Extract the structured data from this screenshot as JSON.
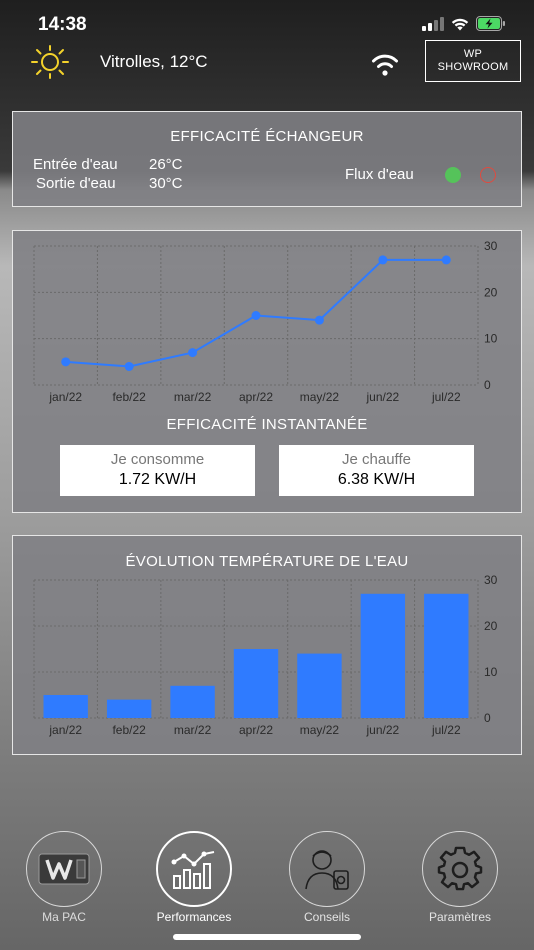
{
  "status": {
    "time": "14:38"
  },
  "header": {
    "location": "Vitrolles, 12°C",
    "showroom_line1": "WP",
    "showroom_line2": "SHOWROOM"
  },
  "exchanger": {
    "title": "EFFICACITÉ ÉCHANGEUR",
    "inlet_label": "Entrée d'eau",
    "inlet_value": "26°C",
    "outlet_label": "Sortie d'eau",
    "outlet_value": "30°C",
    "flow_label": "Flux d'eau",
    "flow_on_color": "#55c35a",
    "flow_off_color": "#e04b3f"
  },
  "instant": {
    "title": "EFFICACITÉ INSTANTANÉE",
    "consume_label": "Je consomme",
    "consume_value": "1.72 KW/H",
    "heat_label": "Je chauffe",
    "heat_value": "6.38 KW/H"
  },
  "water_temp": {
    "title": "ÉVOLUTION TEMPÉRATURE DE L'EAU"
  },
  "chart_data": [
    {
      "type": "line",
      "categories": [
        "jan/22",
        "feb/22",
        "mar/22",
        "apr/22",
        "may/22",
        "jun/22",
        "jul/22"
      ],
      "values": [
        5,
        4,
        7,
        15,
        14,
        27,
        27
      ],
      "yticks": [
        0,
        10,
        20,
        30
      ],
      "ylim": [
        0,
        30
      ],
      "grid": true,
      "color": "#2f7bff"
    },
    {
      "type": "bar",
      "title": "ÉVOLUTION TEMPÉRATURE DE L'EAU",
      "categories": [
        "jan/22",
        "feb/22",
        "mar/22",
        "apr/22",
        "may/22",
        "jun/22",
        "jul/22"
      ],
      "values": [
        5,
        4,
        7,
        15,
        14,
        27,
        27
      ],
      "yticks": [
        0,
        10,
        20,
        30
      ],
      "ylim": [
        0,
        30
      ],
      "grid": true,
      "color": "#2f7bff"
    }
  ],
  "tabs": [
    {
      "label": "Ma PAC",
      "icon": "ma-pac-logo-icon"
    },
    {
      "label": "Performances",
      "icon": "performance-chart-icon"
    },
    {
      "label": "Conseils",
      "icon": "advisor-icon"
    },
    {
      "label": "Paramètres",
      "icon": "gear-icon"
    }
  ]
}
